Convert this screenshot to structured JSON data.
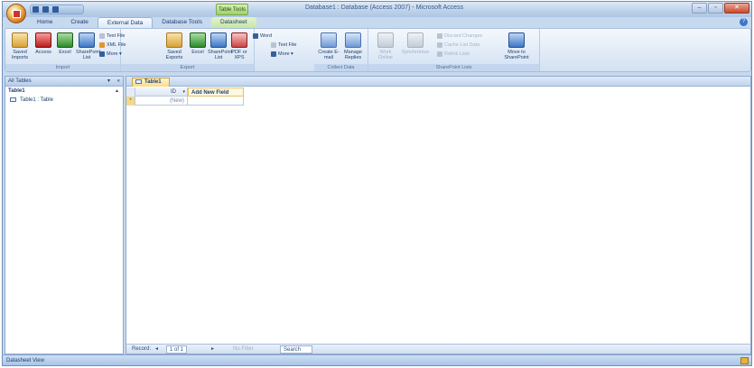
{
  "titlebar": {
    "context_label": "Table Tools",
    "window_title": "Database1 : Database (Access 2007) - Microsoft Access"
  },
  "window_controls": {
    "minimize": "–",
    "maximize": "▫",
    "close": "✕"
  },
  "tabs": {
    "home": "Home",
    "create": "Create",
    "external_data": "External Data",
    "database_tools": "Database Tools",
    "datasheet": "Datasheet"
  },
  "help_label": "?",
  "ribbon": {
    "import": {
      "label": "Import",
      "saved_imports": "Saved Imports",
      "access": "Access",
      "excel": "Excel",
      "sharepoint_list": "SharePoint List",
      "text_file": "Text File",
      "xml_file": "XML File",
      "more": "More ▾"
    },
    "export": {
      "label": "Export",
      "saved_exports": "Saved Exports",
      "excel": "Excel",
      "sharepoint_list": "SharePoint List",
      "pdf_or_xps": "PDF or XPS",
      "word": "Word",
      "text_file": "Text File",
      "more": "More ▾"
    },
    "collect_data": {
      "label": "Collect Data",
      "create_email": "Create E-mail",
      "manage_replies": "Manage Replies"
    },
    "sharepoint_lists": {
      "label": "SharePoint Lists",
      "work_online": "Work Online",
      "synchronize": "Synchronize",
      "discard_changes": "Discard Changes",
      "cache_list_data": "Cache List Data",
      "relink_lists": "Relink Lists",
      "move_to_sharepoint": "Move to SharePoint"
    }
  },
  "nav": {
    "header": "All Tables",
    "dropdown": "▾",
    "collapse": "«",
    "group_name": "Table1",
    "group_chevron": "▲",
    "items": [
      {
        "label": "Table1 : Table"
      }
    ]
  },
  "document": {
    "tab_label": "Table1",
    "columns": {
      "id": "ID",
      "add_field": "Add New Field"
    },
    "new_row": {
      "marker": "*",
      "id_value": "(New)"
    }
  },
  "record_nav": {
    "record_label": "Record:",
    "first": "◂",
    "position": "1 of 1",
    "next": "▸",
    "filter": "No Filter",
    "search": "Search"
  },
  "statusbar": {
    "view_label": "Datasheet View"
  }
}
